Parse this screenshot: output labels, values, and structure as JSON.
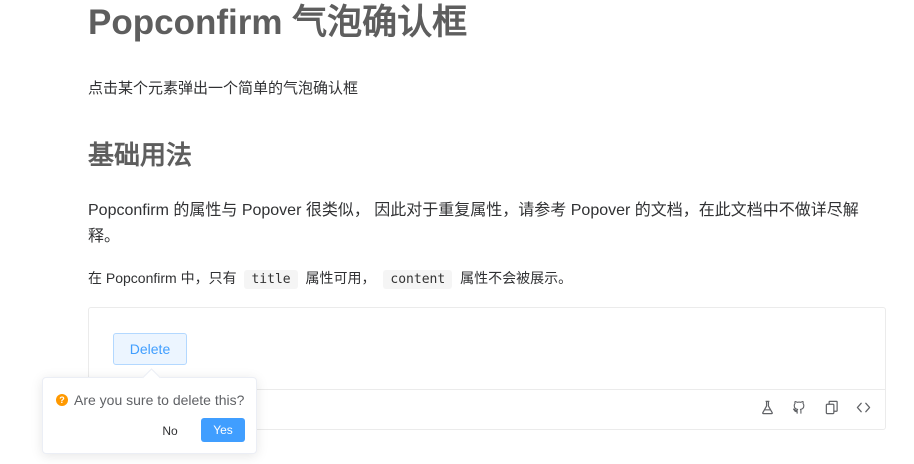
{
  "page": {
    "title": "Popconfirm 气泡确认框",
    "subtitle": "点击某个元素弹出一个简单的气泡确认框",
    "section_title": "基础用法",
    "description": "Popconfirm 的属性与 Popover 很类似， 因此对于重复属性，请参考 Popover 的文档，在此文档中不做详尽解释。",
    "note": {
      "prefix": "在 Popconfirm 中，只有",
      "code1": "title",
      "middle": "属性可用，",
      "code2": "content",
      "suffix": "属性不会被展示。"
    }
  },
  "demo": {
    "delete_label": "Delete",
    "tools": [
      "flask-icon",
      "github-icon",
      "copy-icon",
      "code-icon"
    ]
  },
  "popconfirm": {
    "icon": "question-circle-icon",
    "icon_color": "#ff9900",
    "title": "Are you sure to delete this?",
    "cancel_label": "No",
    "confirm_label": "Yes",
    "primary_color": "#409eff"
  }
}
